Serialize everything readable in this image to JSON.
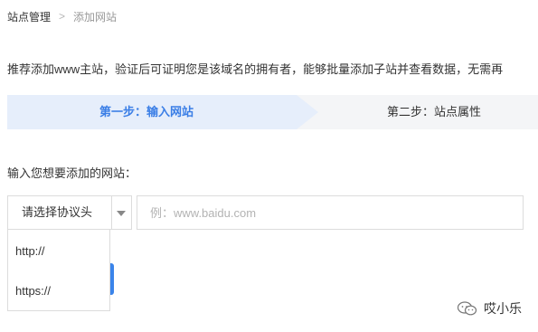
{
  "breadcrumb": {
    "parent": "站点管理",
    "separator": ">",
    "current": "添加网站"
  },
  "intro": "推荐添加www主站，验证后可证明您是该域名的拥有者，能够批量添加子站并查看数据，无需再",
  "steps": [
    {
      "label": "第一步：输入网站",
      "active": true
    },
    {
      "label": "第二步：站点属性",
      "active": false
    }
  ],
  "form": {
    "label": "输入您想要添加的网站：",
    "protocol_select": {
      "selected": "请选择协议头",
      "options": [
        "http://",
        "https://"
      ]
    },
    "url_input": {
      "value": "",
      "placeholder": "例：www.baidu.com"
    }
  },
  "watermark": {
    "icon": "wechat-icon",
    "text": "哎小乐"
  },
  "colors": {
    "accent": "#3a7ee6",
    "active_step_bg": "#e6eefb",
    "steps_bg": "#f4f5f7",
    "border": "#dcdcdc"
  }
}
